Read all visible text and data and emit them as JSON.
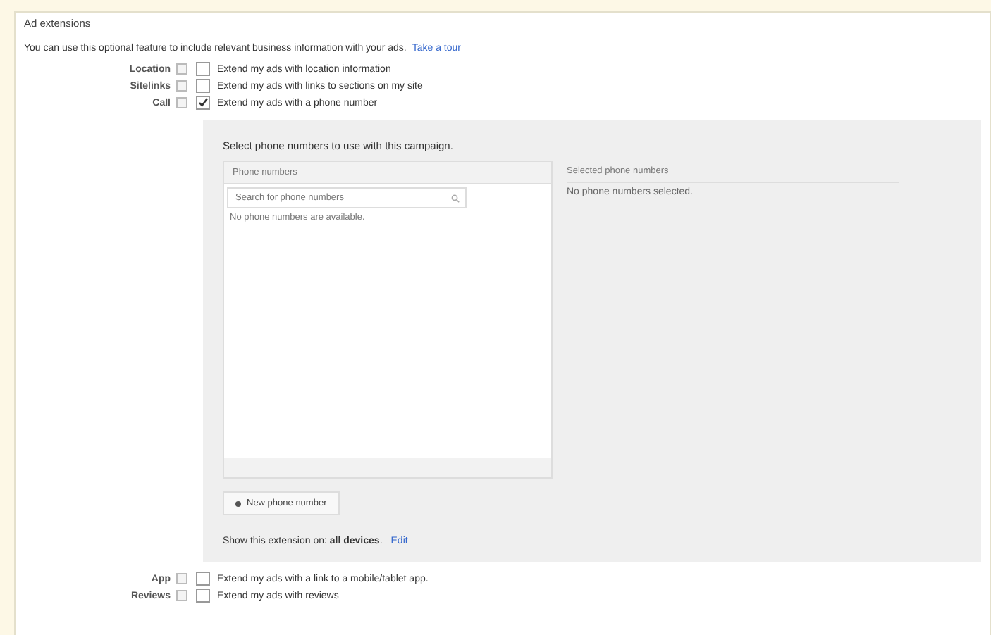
{
  "section_title": "Ad extensions",
  "intro": {
    "text": "You can use this optional feature to include relevant business information with your ads.",
    "link": "Take a tour"
  },
  "extensions_top": [
    {
      "label": "Location",
      "checked": false,
      "description": "Extend my ads with location information"
    },
    {
      "label": "Sitelinks",
      "checked": false,
      "description": "Extend my ads with links to sections on my site"
    },
    {
      "label": "Call",
      "checked": true,
      "description": "Extend my ads with a phone number"
    }
  ],
  "call_panel": {
    "heading": "Select phone numbers to use with this campaign.",
    "list_header": "Phone numbers",
    "search": {
      "placeholder": "Search for phone numbers"
    },
    "empty_message": "No phone numbers are available.",
    "selected_header": "Selected phone numbers",
    "selected_message": "No phone numbers selected.",
    "new_button": "New phone number",
    "devices_text": "Show this extension on: **all devices**.",
    "edit_link": "Edit"
  },
  "extensions_bottom": [
    {
      "label": "App",
      "checked": false,
      "description": "Extend my ads with a link to a mobile/tablet app."
    },
    {
      "label": "Reviews",
      "checked": false,
      "description": "Extend my ads with reviews"
    }
  ]
}
